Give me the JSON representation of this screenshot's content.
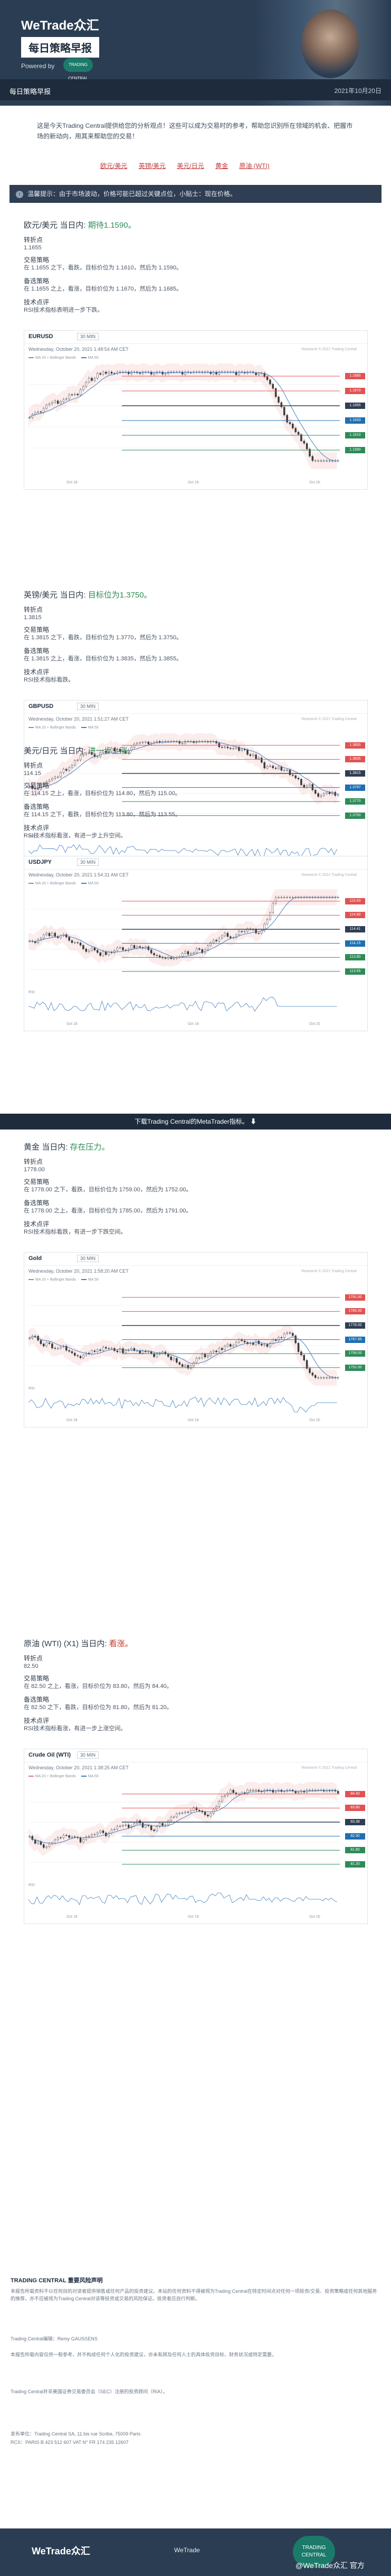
{
  "header": {
    "brand": "WeTrade众汇",
    "tagline": "每日策略早报",
    "powered_by": "Powered by",
    "powered_logo": "TRADING CENTRAL",
    "banner_title": "每日策略早报",
    "date": "2021年10月20日"
  },
  "intro": {
    "text": "这是今天Trading Central提供给您的分析观点！这些可以成为交易时的参考，帮助您识别所在领域的机会、把握市场的新动向，用其来帮助您的交易！",
    "links": [
      "欧元/美元",
      "英镑/美元",
      "美元/日元",
      "黄金",
      "原油 (WTI)"
    ]
  },
  "notice": "温馨提示：由于市场波动，价格可能已超过关键点位，小贴士：现在价格。",
  "sections": [
    {
      "pair": "欧元/美元",
      "view_prefix": "当日内:",
      "view": "期待1.1590。",
      "pivot_label": "转折点",
      "pivot": "1.1655",
      "trade_label": "交易策略",
      "trade": "在 1.1655 之下，看跌，目标价位为 1.1610，然后为 1.1590。",
      "alt_label": "备选策略",
      "alt": "在 1.1655 之上，看涨，目标价位为 1.1670，然后为 1.1685。",
      "comment_label": "技术点评",
      "comment": "RSI技术指标表明进一步下跌。",
      "chart": {
        "symbol": "EURUSD",
        "tf": "30 MIN",
        "ts": "Wednesday, October 20, 2021 1:48:54 AM CET",
        "copyright": "Research © 2021 Trading Central",
        "legend": [
          "MA 20 + Bollinger Bands",
          "MA 50"
        ],
        "levels": [
          "1.1685",
          "1.1670",
          "1.1655",
          "1.1633",
          "1.1610",
          "1.1590"
        ],
        "x_labels": [
          "Oct 18",
          "Oct 19",
          "Oct 20"
        ]
      }
    },
    {
      "pair": "英镑/美元",
      "view_prefix": "当日内:",
      "view": "目标位为1.3750。",
      "pivot_label": "转折点",
      "pivot": "1.3815",
      "trade_label": "交易策略",
      "trade": "在 1.3815 之下，看跌，目标价位为 1.3770，然后为 1.3750。",
      "alt_label": "备选策略",
      "alt": "在 1.3815 之上，看涨，目标价位为 1.3835，然后为 1.3855。",
      "comment_label": "技术点评",
      "comment": "RSI技术指标看跌。",
      "chart": {
        "symbol": "GBPUSD",
        "tf": "30 MIN",
        "ts": "Wednesday, October 20, 2021 1:51:27 AM CET",
        "copyright": "Research © 2021 Trading Central",
        "legend": [
          "MA 20 + Bollinger Bands",
          "MA 50"
        ],
        "levels": [
          "1.3855",
          "1.3835",
          "1.3815",
          "1.3797",
          "1.3770",
          "1.3750"
        ],
        "rsi_label": "RSI",
        "x_labels": [
          "Oct 18",
          "Oct 19",
          "Oct 20"
        ]
      }
    },
    {
      "pair": "美元/日元",
      "view_prefix": "当日内:",
      "view": "进一步上涨。",
      "pivot_label": "转折点",
      "pivot": "114.15",
      "trade_label": "交易策略",
      "trade": "在 114.15 之上，看涨，目标价位为 114.80，然后为 115.00。",
      "alt_label": "备选策略",
      "alt": "在 114.15 之下，看跌，目标价位为 113.80，然后为 113.55。",
      "comment_label": "技术点评",
      "comment": "RSI技术指标看涨，有进一步上升空间。",
      "chart": {
        "symbol": "USDJPY",
        "tf": "30 MIN",
        "ts": "Wednesday, October 20, 2021 1:54:31 AM CET",
        "copyright": "Research © 2021 Trading Central",
        "legend": [
          "MA 20 + Bollinger Bands",
          "MA 50"
        ],
        "levels": [
          "115.00",
          "114.80",
          "114.41",
          "114.15",
          "113.80",
          "113.55"
        ],
        "rsi_label": "RSI",
        "x_labels": [
          "Oct 18",
          "Oct 19",
          "Oct 20"
        ]
      }
    },
    {
      "pair": "黄金",
      "view_prefix": "当日内:",
      "view": "存在压力。",
      "pivot_label": "转折点",
      "pivot": "1778.00",
      "trade_label": "交易策略",
      "trade": "在 1778.00 之下，看跌，目标价位为 1759.00，然后为 1752.00。",
      "alt_label": "备选策略",
      "alt": "在 1778.00 之上，看涨，目标价位为 1785.00，然后为 1791.00。",
      "comment_label": "技术点评",
      "comment": "RSI技术指标看跌，有进一步下跌空间。",
      "chart": {
        "symbol": "Gold",
        "tf": "30 MIN",
        "ts": "Wednesday, October 20, 2021 1:58:20 AM CET",
        "copyright": "Research © 2021 Trading Central",
        "legend": [
          "MA 20 + Bollinger Bands",
          "MA 50"
        ],
        "levels": [
          "1791.00",
          "1785.00",
          "1778.00",
          "1767.95",
          "1759.00",
          "1752.00"
        ],
        "rsi_label": "RSI",
        "x_labels": [
          "Oct 18",
          "Oct 19",
          "Oct 20"
        ]
      }
    },
    {
      "pair": "原油 (WTI) (X1)",
      "view_prefix": "当日内:",
      "view": "看涨。",
      "view_class": "bear",
      "pivot_label": "转折点",
      "pivot": "82.50",
      "trade_label": "交易策略",
      "trade": "在 82.50 之上，看涨，目标价位为 83.80，然后为 84.40。",
      "alt_label": "备选策略",
      "alt": "在 82.50 之下，看跌，目标价位为 81.80，然后为 81.20。",
      "comment_label": "技术点评",
      "comment": "RSI技术指标看涨，有进一步上涨空间。",
      "chart": {
        "symbol": "Crude Oil (WTI)",
        "tf": "30 MIN",
        "ts": "Wednesday, October 20, 2021 1:38:25 AM CET",
        "copyright": "Research © 2021 Trading Central",
        "legend": [
          "MA 20 + Bollinger Bands",
          "MA 50"
        ],
        "levels": [
          "84.40",
          "83.80",
          "83.38",
          "82.50",
          "81.80",
          "81.20"
        ],
        "rsi_label": "RSI",
        "x_labels": [
          "Oct 18",
          "Oct 19",
          "Oct 20"
        ]
      }
    }
  ],
  "download": "下载Trading Central的MetaTrader指标。",
  "footer": {
    "head": "TRADING CENTRAL 重要风险声明",
    "p1": "本报告所载资料不以任何目的对读者提供销售或任何产品的投资建议。本站的任何资料不得被视为Trading Central在特定时间点对任何一项投资/交易、投资策略或任何其他服务的推荐，亦不应被视为Trading Central对该等投资或交易的风险保证。投资者应自行判断。",
    "p2": "Trading Central编辑：Remy GAUSSENS",
    "p3": "本报告所载内容仅供一般参考，并不构成任何个人化的投资建议，亦未有顾及任何人士的具体投资目标、财务状况或特定需要。",
    "p4": "Trading Central并非美国证券交易委员会（SEC）注册的投资顾问（RIA）。",
    "p5": "发布单位：Trading Central SA, 11 bis rue Scribe, 75009 Paris",
    "p6": "RCS：PARIS B 423 512 607 VAT N° FR 174 235 12607"
  },
  "bottom": {
    "logo": "WeTrade众汇",
    "mid": "WeTrade",
    "badge": "TRADING CENTRAL",
    "weibo": "@WeTrade众汇 官方"
  },
  "colors": {
    "primary": "#2b3d53",
    "accent_red": "#c0392b",
    "accent_green": "#2e8b57"
  }
}
